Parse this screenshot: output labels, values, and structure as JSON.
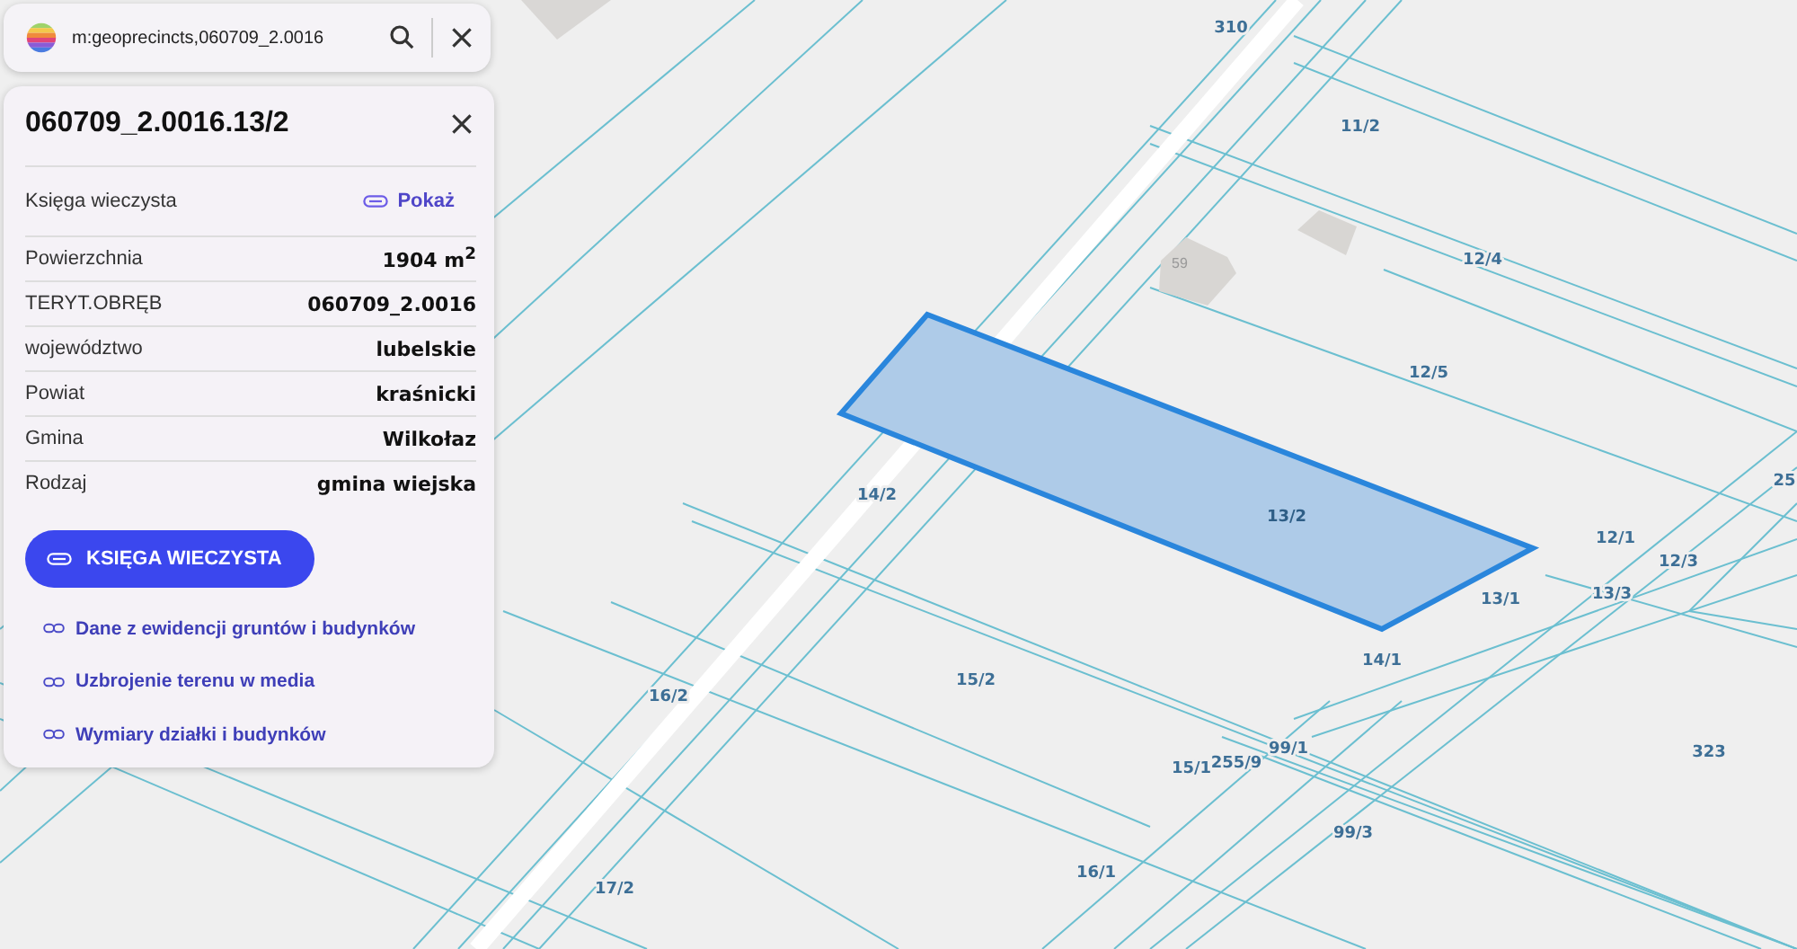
{
  "search": {
    "value": "m:geoprecincts,060709_2.0016"
  },
  "details": {
    "title": "060709_2.0016.13/2",
    "land_register": {
      "label": "Księga wieczysta",
      "link": "Pokaż"
    },
    "rows": [
      {
        "label": "Powierzchnia",
        "value": "1904 m$^{2}$"
      },
      {
        "label": "TERYT.OBRĘB",
        "value": "060709_2.0016"
      },
      {
        "label": "województwo",
        "value": "lubelskie"
      },
      {
        "label": "Powiat",
        "value": "kraśnicki"
      },
      {
        "label": "Gmina",
        "value": "Wilkołaz"
      },
      {
        "label": "Rodzaj",
        "value": "gmina wiejska"
      }
    ],
    "primary_button": "KSIĘGA WIECZYSTA",
    "links": [
      "Dane z ewidencji gruntów i budynków",
      "Uzbrojenie terenu w media",
      "Wymiary działki i budynków"
    ]
  },
  "map": {
    "building_number": "59",
    "parcels": [
      {
        "label": "310",
        "selected": false
      },
      {
        "label": "11/2",
        "selected": false
      },
      {
        "label": "12/4",
        "selected": false
      },
      {
        "label": "12/5",
        "selected": false
      },
      {
        "label": "14/2",
        "selected": false
      },
      {
        "label": "13/2",
        "selected": true
      },
      {
        "label": "12/1",
        "selected": false
      },
      {
        "label": "12/3",
        "selected": false
      },
      {
        "label": "13/1",
        "selected": false
      },
      {
        "label": "13/3",
        "selected": false
      },
      {
        "label": "14/1",
        "selected": false
      },
      {
        "label": "16/2",
        "selected": false
      },
      {
        "label": "15/2",
        "selected": false
      },
      {
        "label": "323",
        "selected": false
      },
      {
        "label": "15/1",
        "selected": false
      },
      {
        "label": "255/9",
        "selected": false
      },
      {
        "label": "99/1",
        "selected": false
      },
      {
        "label": "99/3",
        "selected": false
      },
      {
        "label": "16/1",
        "selected": false
      },
      {
        "label": "17/2",
        "selected": false
      },
      {
        "label": "25",
        "selected": false
      }
    ]
  }
}
